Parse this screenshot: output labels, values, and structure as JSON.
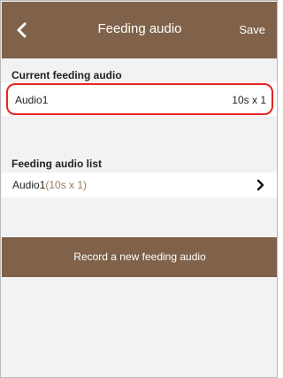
{
  "header": {
    "back_icon": "chevron-left-icon",
    "title": "Feeding audio",
    "save_label": "Save"
  },
  "current": {
    "section_label": "Current feeding audio",
    "name": "Audio1",
    "duration": "10s x 1"
  },
  "list": {
    "section_label": "Feeding audio list",
    "items": [
      {
        "name": "Audio1",
        "detail": "(10s x 1)",
        "chevron_icon": "chevron-right-icon"
      }
    ]
  },
  "record": {
    "label": "Record a new feeding audio"
  },
  "colors": {
    "header_bg": "#7f6249",
    "accent_detail": "#9b7a5c",
    "highlight_border": "#e52521",
    "page_bg": "#f2f2f2"
  }
}
